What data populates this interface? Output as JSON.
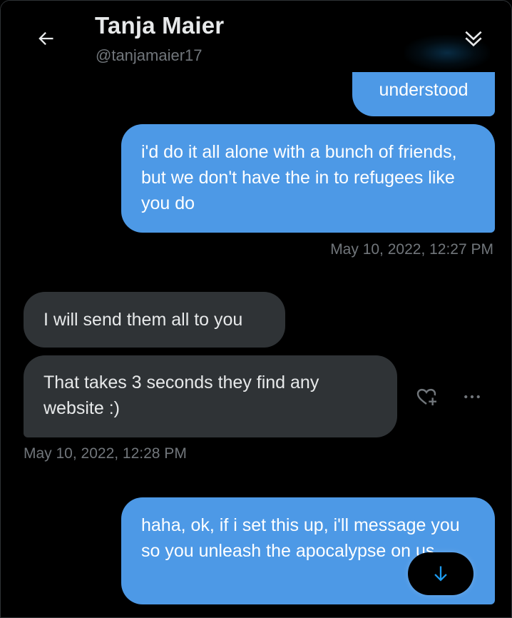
{
  "header": {
    "title": "Tanja Maier",
    "handle": "@tanjamaier17",
    "back_icon": "arrow-left-icon",
    "collapse_icon": "double-chevron-down-icon"
  },
  "messages": [
    {
      "side": "sent",
      "text": "understood"
    },
    {
      "side": "sent",
      "text": "i'd do it all alone with a bunch of friends, but we don't have the in to refugees like you do"
    },
    {
      "side": "received",
      "text": "I will send them all to you"
    },
    {
      "side": "received",
      "text": "That takes 3 seconds they find any website :)"
    },
    {
      "side": "sent",
      "text": "haha, ok, if i set this up, i'll message you so you unleash the apocalypse on us"
    }
  ],
  "timestamps": {
    "sent_group": "May 10, 2022, 12:27 PM",
    "received_group": "May 10, 2022, 12:28 PM"
  },
  "actions": {
    "react_icon": "heart-plus-icon",
    "more_icon": "more-horizontal-icon",
    "scroll_icon": "arrow-down-icon"
  },
  "colors": {
    "sent_bubble": "#4d99e6",
    "received_bubble": "#2f3336",
    "accent": "#1d9bf0",
    "muted_text": "#71767b"
  }
}
